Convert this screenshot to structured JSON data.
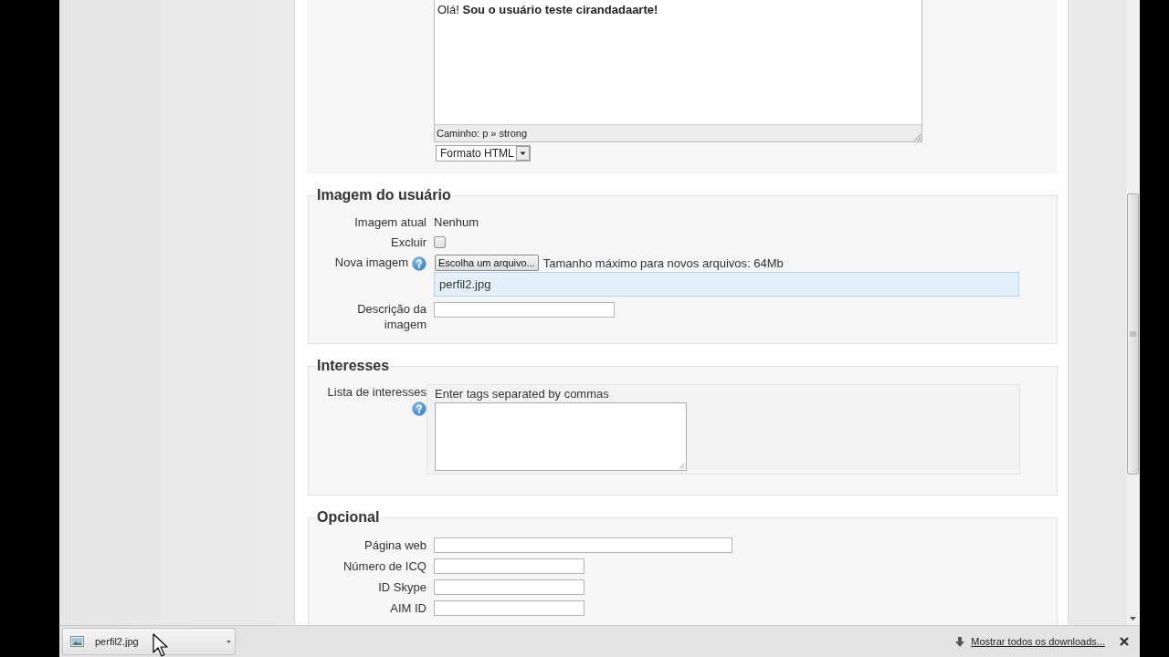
{
  "editor": {
    "content": "Olá! **Sou o usuário teste cirandadaarte!**",
    "path": "Caminho: p » strong",
    "format": "Formato HTML"
  },
  "sections": [
    {
      "legend": "Imagem do usuário",
      "rows": [
        {
          "kind": "text",
          "label": "Imagem atual",
          "help": false,
          "value": "Nenhum"
        },
        {
          "kind": "checkbox",
          "label": "Excluir",
          "help": false,
          "checked": false
        },
        {
          "kind": "file",
          "label": "Nova imagem",
          "help": true,
          "button": "Escolha um arquivo...",
          "note": "Tamanho máximo para novos arquivos: 64Mb",
          "file": "perfil2.jpg"
        },
        {
          "kind": "description",
          "label": "Descrição da imagem",
          "help": false
        }
      ]
    },
    {
      "legend": "Interesses",
      "rows": [
        {
          "kind": "tags",
          "label": "Lista de interesses",
          "help": true,
          "hint": "Enter tags separated by commas"
        }
      ]
    },
    {
      "legend": "Opcional",
      "rows": [
        {
          "kind": "url",
          "label": "Página web",
          "help": false
        },
        {
          "kind": "id",
          "label": "Número de ICQ",
          "help": false
        },
        {
          "kind": "id",
          "label": "ID Skype",
          "help": false
        },
        {
          "kind": "id",
          "label": "AIM ID",
          "help": false
        }
      ]
    }
  ],
  "downloads": {
    "items": [
      {
        "name": "perfil2.jpg"
      }
    ],
    "show_all": "Mostrar todos os downloads..."
  }
}
